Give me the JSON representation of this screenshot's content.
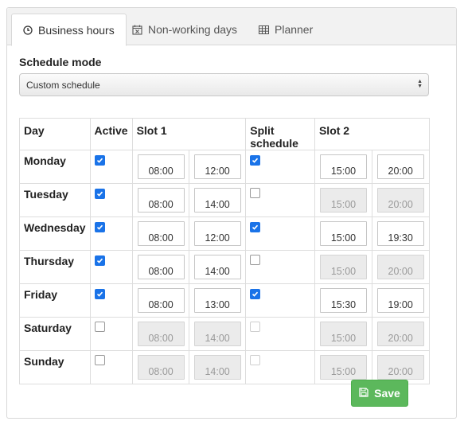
{
  "tabs": [
    {
      "label": "Business hours",
      "icon": "clock-icon",
      "active": true
    },
    {
      "label": "Non-working days",
      "icon": "calendar-x-icon",
      "active": false
    },
    {
      "label": "Planner",
      "icon": "table-icon",
      "active": false
    }
  ],
  "schedule_mode": {
    "label": "Schedule mode",
    "selected": "Custom schedule"
  },
  "table": {
    "headers": {
      "day": "Day",
      "active": "Active",
      "slot1": "Slot 1",
      "split": "Split schedule",
      "slot2": "Slot 2"
    },
    "rows": [
      {
        "day": "Monday",
        "active": true,
        "s1_start": "08:00",
        "s1_end": "12:00",
        "split": true,
        "s2_start": "15:00",
        "s2_end": "20:00"
      },
      {
        "day": "Tuesday",
        "active": true,
        "s1_start": "08:00",
        "s1_end": "14:00",
        "split": false,
        "s2_start": "15:00",
        "s2_end": "20:00"
      },
      {
        "day": "Wednesday",
        "active": true,
        "s1_start": "08:00",
        "s1_end": "12:00",
        "split": true,
        "s2_start": "15:00",
        "s2_end": "19:30"
      },
      {
        "day": "Thursday",
        "active": true,
        "s1_start": "08:00",
        "s1_end": "14:00",
        "split": false,
        "s2_start": "15:00",
        "s2_end": "20:00"
      },
      {
        "day": "Friday",
        "active": true,
        "s1_start": "08:00",
        "s1_end": "13:00",
        "split": true,
        "s2_start": "15:30",
        "s2_end": "19:00"
      },
      {
        "day": "Saturday",
        "active": false,
        "s1_start": "08:00",
        "s1_end": "14:00",
        "split": false,
        "s2_start": "15:00",
        "s2_end": "20:00"
      },
      {
        "day": "Sunday",
        "active": false,
        "s1_start": "08:00",
        "s1_end": "14:00",
        "split": false,
        "s2_start": "15:00",
        "s2_end": "20:00"
      }
    ]
  },
  "save_button": {
    "label": "Save",
    "icon": "floppy-disk-icon"
  },
  "colors": {
    "accent_check": "#1a73e8",
    "save_green": "#5cb85c",
    "disabled_input": "#ebebeb"
  }
}
